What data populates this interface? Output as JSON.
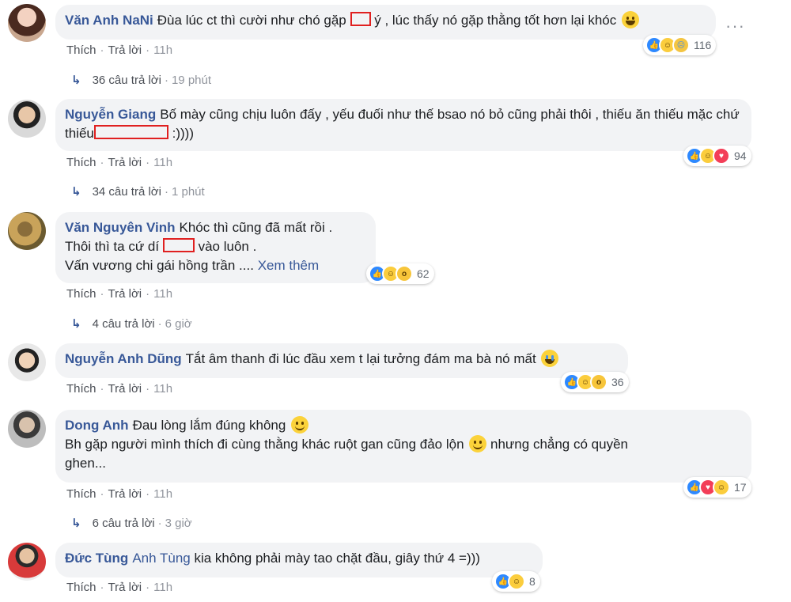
{
  "action_like": "Thích",
  "action_reply": "Trả lời",
  "sep": "·",
  "more_icon": "more-dots-icon",
  "comments": [
    {
      "author": "Văn Anh NaNi",
      "text1": "Đùa lúc ct thì cười như chó gặp",
      "text2": "ý , lúc thấy nó gặp thằng tốt hơn lại khóc",
      "time": "11h",
      "reaction_count": "116",
      "replies_label": "36 câu trả lời",
      "replies_time": "19 phút"
    },
    {
      "author": "Nguyễn Giang",
      "text1": "Bố mày cũng chịu luôn đấy , yếu đuối như thế bsao nó bỏ cũng phải thôi , thiếu ăn thiếu mặc chứ thiếu",
      "text2": ":))))",
      "time": "11h",
      "reaction_count": "94",
      "replies_label": "34 câu trả lời",
      "replies_time": "1 phút"
    },
    {
      "author": "Văn Nguyên Vinh",
      "line1": "Khóc thì cũng đã mất rồi .",
      "line2a": "Thôi thì ta cứ dí",
      "line2b": "vào luôn .",
      "line3": "Vấn vương chi gái hồng trần ....",
      "see_more": "Xem thêm",
      "time": "11h",
      "reaction_count": "62",
      "replies_label": "4 câu trả lời",
      "replies_time": "6 giờ"
    },
    {
      "author": "Nguyễn Anh Dũng",
      "text": "Tắt âm thanh đi lúc đầu xem t lại tưởng đám ma bà nó mất",
      "time": "11h",
      "reaction_count": "36"
    },
    {
      "author": "Dong Anh",
      "line1": "Đau lòng lắm đúng không",
      "line2a": "Bh gặp người mình thích đi cùng thằng khác ruột gan cũng đảo lộn",
      "line2b": "nhưng chẳng có quyền",
      "line3": "ghen...",
      "time": "11h",
      "reaction_count": "17",
      "replies_label": "6 câu trả lời",
      "replies_time": "3 giờ"
    },
    {
      "author": "Đức Tùng",
      "tag": "Anh Tùng",
      "text": "kia không phải mày tao chặt đầu, giây thứ 4 =)))",
      "time": "11h",
      "reaction_count": "8"
    }
  ]
}
